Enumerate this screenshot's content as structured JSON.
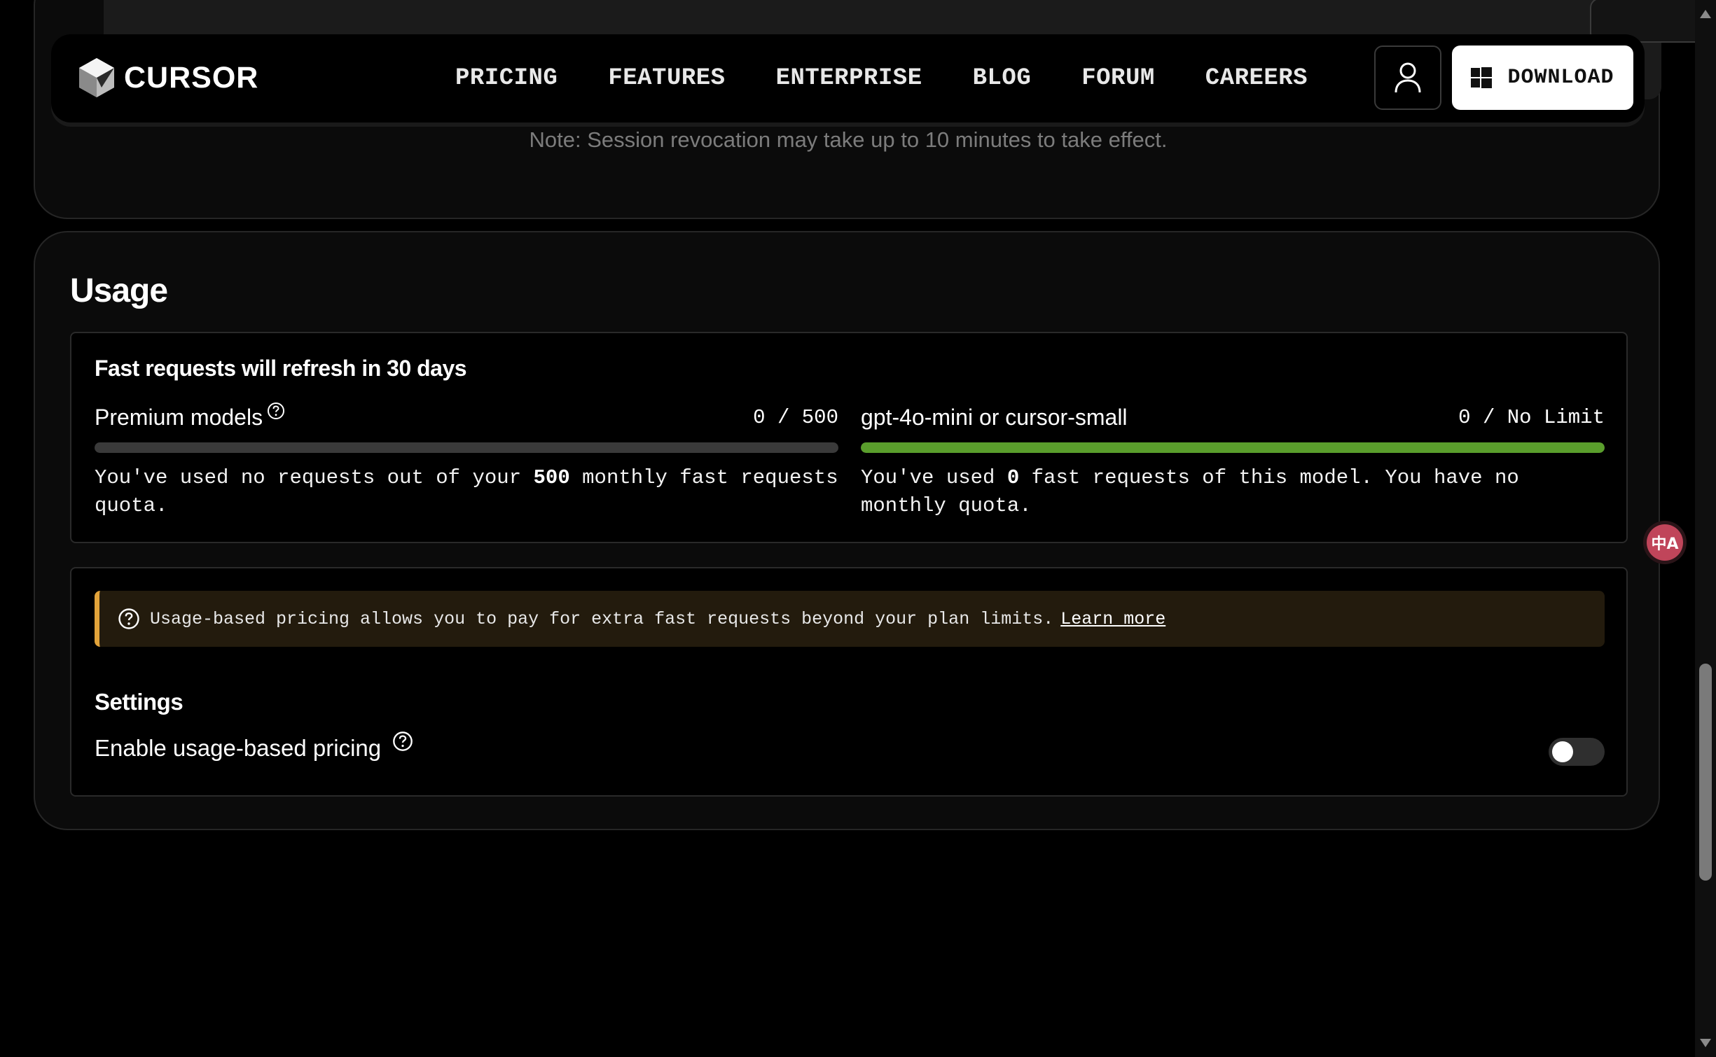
{
  "nav": {
    "brand": "CURSOR",
    "links": [
      "PRICING",
      "FEATURES",
      "ENTERPRISE",
      "BLOG",
      "FORUM",
      "CAREERS"
    ],
    "download_label": "DOWNLOAD"
  },
  "session": {
    "note": "Note: Session revocation may take up to 10 minutes to take effect."
  },
  "usage": {
    "title": "Usage",
    "refresh_label": "Fast requests will refresh in 30 days",
    "premium": {
      "name": "Premium models",
      "count": "0 / 500",
      "used": 0,
      "limit": 500,
      "fill_fraction": 0,
      "desc_pre": "You've used no requests out of your ",
      "desc_num": "500",
      "desc_post": " monthly fast requests quota."
    },
    "mini": {
      "name": "gpt-4o-mini or cursor-small",
      "count": "0 / No Limit",
      "used": 0,
      "fill_fraction": 1,
      "bar_color": "#5a9e2c",
      "desc_pre": "You've used ",
      "desc_num": "0",
      "desc_post": " fast requests of this model. You have no monthly quota."
    },
    "notice": {
      "text": "Usage-based pricing allows you to pay for extra fast requests beyond your plan limits.",
      "link": "Learn more",
      "accent_color": "#e2a33a"
    },
    "settings": {
      "title": "Settings",
      "toggle_label": "Enable usage-based pricing",
      "enabled": false
    }
  },
  "translate_widget": {
    "glyph": "中A"
  }
}
